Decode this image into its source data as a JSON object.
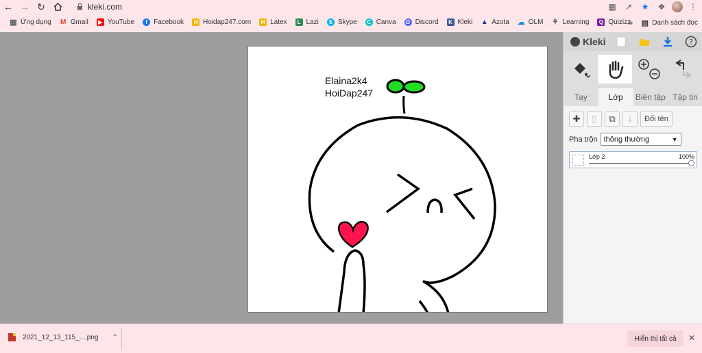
{
  "browser": {
    "url": "kleki.com",
    "bookmarks": [
      {
        "label": "Ứng dụng",
        "icon": "apps-grid-icon",
        "color": "#5f6368"
      },
      {
        "label": "Gmail",
        "icon": "gmail-icon",
        "color": "#ea4335"
      },
      {
        "label": "YouTube",
        "icon": "youtube-icon",
        "color": "#ff0000"
      },
      {
        "label": "Facebook",
        "icon": "facebook-icon",
        "color": "#1877f2"
      },
      {
        "label": "Hoidap247.com",
        "icon": "hoidap-icon",
        "color": "#f4b400"
      },
      {
        "label": "Latex",
        "icon": "latex-icon",
        "color": "#f4b400"
      },
      {
        "label": "Lazi",
        "icon": "lazi-icon",
        "color": "#2e8b57"
      },
      {
        "label": "Skype",
        "icon": "skype-icon",
        "color": "#00aff0"
      },
      {
        "label": "Canva",
        "icon": "canva-icon",
        "color": "#00c4cc"
      },
      {
        "label": "Discord",
        "icon": "discord-icon",
        "color": "#5865f2"
      },
      {
        "label": "Kleki",
        "icon": "kleki-icon",
        "color": "#3b5998"
      },
      {
        "label": "Azota",
        "icon": "azota-icon",
        "color": "#1a3a8a"
      },
      {
        "label": "OLM",
        "icon": "olm-icon",
        "color": "#1e88e5"
      },
      {
        "label": "Learning",
        "icon": "learning-icon",
        "color": "#555555"
      },
      {
        "label": "Quizizz",
        "icon": "quizizz-icon",
        "color": "#7b1fa2"
      }
    ],
    "more_bookmarks": "»",
    "reading_list": "Danh sách đọc"
  },
  "canvas": {
    "text_lines": [
      "Elaina2k4",
      "HoiDap247"
    ]
  },
  "panel": {
    "logo": "Kleki",
    "tabs": [
      {
        "label": "Tay",
        "active": false
      },
      {
        "label": "Lớp",
        "active": true
      },
      {
        "label": "Biên tập",
        "active": false
      },
      {
        "label": "Tập tin",
        "active": false
      }
    ],
    "rename_label": "Đổi tên",
    "blend_label": "Pha trộn",
    "blend_value": "thông thường",
    "layer": {
      "name": "Lớp 2",
      "opacity": "100%"
    }
  },
  "downloads": {
    "file": "2021_12_13_115_....png",
    "show_all": "Hiển thị tất cả"
  }
}
